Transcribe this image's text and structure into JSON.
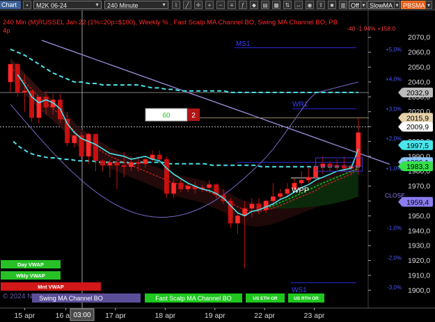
{
  "toolbar": {
    "chart_tag": "Chart",
    "symbol": "M2K 06-24",
    "interval": "240 Minute",
    "toggle1": "Off",
    "toggle2": "SlowMA",
    "toggle3": "PBSMA"
  },
  "header": {
    "title": "240 Min (M)RUSSEL Jan 22 (1%=20p=$100), Weekly % , Fast Scalp MA Channel BO, Swing MA Channel BO, PB",
    "subtitle": "4p",
    "change": "-40 -1.94% +158.0"
  },
  "levels": {
    "ms1": "MS1",
    "wr1": "WR1",
    "wpp": "WPP",
    "ws1": "WS1",
    "close": "CLOSE"
  },
  "box": {
    "left_value": "60",
    "right_value": "2"
  },
  "price_tags": [
    {
      "text": "2032,9",
      "price": 2032.9,
      "bg": "#bcbcbc",
      "fg": "#000000"
    },
    {
      "text": "2015,9",
      "price": 2015.9,
      "bg": "#e6d2aa",
      "fg": "#000000"
    },
    {
      "text": "2009,9",
      "price": 2009.9,
      "bg": "#ffffff",
      "fg": "#000000"
    },
    {
      "text": "1997,5",
      "price": 1997.5,
      "bg": "#49e6ec",
      "fg": "#000000"
    },
    {
      "text": "1986,1",
      "price": 1986.1,
      "bg": "#8cc6ff",
      "fg": "#000000"
    },
    {
      "text": "1983,3",
      "price": 1983.3,
      "bg": "#35e04a",
      "fg": "#000000"
    },
    {
      "text": "1959,4",
      "price": 1959.4,
      "bg": "#8b7cf0",
      "fg": "#000000"
    }
  ],
  "legend_buttons": {
    "day_vwap": "Day VWAP",
    "wkly_vwap": "Wkly VWAP",
    "mnt_vwap": "Mnt VWAP",
    "swing": "Swing MA Channel BO",
    "fast": "Fast Scalp MA Channel BO",
    "us_eth": "US ETH OR",
    "us_rth": "US RTH OR"
  },
  "copyright": "© 2024 NinjaTrader, LLC",
  "crosshair_time": "03:00",
  "colors": {
    "up": "#ff2020",
    "down": "#c80000",
    "fast_ma": "#49e6ec",
    "slow_ma": "#e02020",
    "swing_upper": "#9080d0",
    "trend_green": "#30d040",
    "pivot_blue": "#3a3ad8",
    "crosshair": "#c8c8c8"
  },
  "chart_data": {
    "type": "candlestick",
    "symbol": "M2K 06-24",
    "interval": "240 Minute",
    "y_axis": {
      "range": [
        1895,
        2075
      ],
      "ticks": [
        2070,
        2060,
        2050,
        2040,
        2030,
        2020,
        2010,
        2000,
        1990,
        1980,
        1970,
        1960,
        1950,
        1940,
        1930,
        1920,
        1910,
        1900
      ],
      "tick_labels": [
        "2070,0",
        "2060,0",
        "2050,0",
        "2040,0",
        "2030,0",
        "2020,0",
        "2010,0",
        "2000,0",
        "1990,0",
        "1980,0",
        "1970,0",
        "1960,0",
        "1950,0",
        "1940,0",
        "1930,0",
        "1920,0",
        "1910,0",
        "1900,0"
      ]
    },
    "pct_axis": [
      {
        "label": "+5,0%",
        "price": 2062
      },
      {
        "label": "+4,0%",
        "price": 2042
      },
      {
        "label": "+3,0%",
        "price": 2022
      },
      {
        "label": "+2,0%",
        "price": 2002
      },
      {
        "label": "+1,0%",
        "price": 1982
      },
      {
        "label": "-1,0%",
        "price": 1942
      },
      {
        "label": "-2,0%",
        "price": 1922
      },
      {
        "label": "-3,0%",
        "price": 1902
      }
    ],
    "x_labels": [
      {
        "label": "15 apr",
        "index": 2
      },
      {
        "label": "16 apr",
        "index": 7.8
      },
      {
        "label": "17 apr",
        "index": 14.8
      },
      {
        "label": "18 apr",
        "index": 21.8
      },
      {
        "label": "19 apr",
        "index": 28.8
      },
      {
        "label": "22 apr",
        "index": 35.8
      },
      {
        "label": "23 apr",
        "index": 42.8
      }
    ],
    "candles": [
      {
        "o": 2040,
        "h": 2051,
        "c": 2052,
        "l": 2033
      },
      {
        "o": 2052,
        "h": 2053,
        "c": 2033,
        "l": 2030
      },
      {
        "o": 2033,
        "h": 2045,
        "c": 2034,
        "l": 2020
      },
      {
        "o": 2034,
        "h": 2033,
        "c": 2016,
        "l": 2013
      },
      {
        "o": 2016,
        "h": 2030,
        "c": 2030,
        "l": 2012
      },
      {
        "o": 2030,
        "h": 2034,
        "c": 2023,
        "l": 2018
      },
      {
        "o": 2023,
        "h": 2032,
        "c": 2028,
        "l": 2018
      },
      {
        "o": 2028,
        "h": 2032,
        "c": 2015,
        "l": 2012
      },
      {
        "o": 2015,
        "h": 2020,
        "c": 1999,
        "l": 1997
      },
      {
        "o": 1999,
        "h": 2004,
        "c": 2004,
        "l": 1996
      },
      {
        "o": 2004,
        "h": 2006,
        "c": 1990,
        "l": 1988
      },
      {
        "o": 1990,
        "h": 2006,
        "c": 2005,
        "l": 1985
      },
      {
        "o": 2005,
        "h": 2005,
        "c": 1987,
        "l": 1980
      },
      {
        "o": 1987,
        "h": 1988,
        "c": 1984,
        "l": 1980
      },
      {
        "o": 1984,
        "h": 1988,
        "c": 1986,
        "l": 1976
      },
      {
        "o": 1986,
        "h": 1988,
        "c": 1984,
        "l": 1968
      },
      {
        "o": 1984,
        "h": 1993,
        "c": 1983,
        "l": 1976
      },
      {
        "o": 1983,
        "h": 1990,
        "c": 1986,
        "l": 1980
      },
      {
        "o": 1986,
        "h": 1990,
        "c": 1985,
        "l": 1980
      },
      {
        "o": 1985,
        "h": 1990,
        "c": 1988,
        "l": 1982
      },
      {
        "o": 1988,
        "h": 1994,
        "c": 1991,
        "l": 1986
      },
      {
        "o": 1991,
        "h": 1994,
        "c": 1988,
        "l": 1985
      },
      {
        "o": 1988,
        "h": 1990,
        "c": 1965,
        "l": 1962
      },
      {
        "o": 1965,
        "h": 1975,
        "c": 1972,
        "l": 1962
      },
      {
        "o": 1972,
        "h": 1975,
        "c": 1968,
        "l": 1966
      },
      {
        "o": 1968,
        "h": 1972,
        "c": 1970,
        "l": 1966
      },
      {
        "o": 1970,
        "h": 1973,
        "c": 1968,
        "l": 1965
      },
      {
        "o": 1968,
        "h": 1971,
        "c": 1969,
        "l": 1966
      },
      {
        "o": 1969,
        "h": 1974,
        "c": 1971,
        "l": 1966
      },
      {
        "o": 1971,
        "h": 1972,
        "c": 1964,
        "l": 1962
      },
      {
        "o": 1964,
        "h": 1968,
        "c": 1960,
        "l": 1958
      },
      {
        "o": 1960,
        "h": 1962,
        "c": 1945,
        "l": 1942
      },
      {
        "o": 1945,
        "h": 1952,
        "c": 1950,
        "l": 1938
      },
      {
        "o": 1950,
        "h": 1960,
        "c": 1955,
        "l": 1915
      },
      {
        "o": 1955,
        "h": 1962,
        "c": 1958,
        "l": 1949
      },
      {
        "o": 1958,
        "h": 1962,
        "c": 1954,
        "l": 1951
      },
      {
        "o": 1954,
        "h": 1961,
        "c": 1960,
        "l": 1952
      },
      {
        "o": 1960,
        "h": 1972,
        "c": 1963,
        "l": 1955
      },
      {
        "o": 1963,
        "h": 1968,
        "c": 1965,
        "l": 1961
      },
      {
        "o": 1965,
        "h": 1972,
        "c": 1968,
        "l": 1962
      },
      {
        "o": 1968,
        "h": 1975,
        "c": 1972,
        "l": 1966
      },
      {
        "o": 1972,
        "h": 1980,
        "c": 1974,
        "l": 1970
      },
      {
        "o": 1974,
        "h": 1982,
        "c": 1976,
        "l": 1972
      },
      {
        "o": 1976,
        "h": 1985,
        "c": 1983,
        "l": 1974
      },
      {
        "o": 1983,
        "h": 1990,
        "c": 1985,
        "l": 1978
      },
      {
        "o": 1985,
        "h": 1987,
        "c": 1983,
        "l": 1980
      },
      {
        "o": 1983,
        "h": 1988,
        "c": 1984,
        "l": 1981
      },
      {
        "o": 1984,
        "h": 1990,
        "c": 1982,
        "l": 1980
      },
      {
        "o": 1982,
        "h": 1985,
        "c": 1983,
        "l": 1978
      },
      {
        "o": 1983,
        "h": 2016,
        "c": 2006,
        "l": 1978
      }
    ],
    "series": [
      {
        "name": "Fast Scalp MA",
        "values": [
          null,
          2045,
          2038,
          2030,
          2026,
          2028,
          2026,
          2022,
          2012,
          2006,
          2002,
          2000,
          1998,
          1995,
          1992,
          1991,
          1990,
          1988,
          1989,
          1990,
          1988,
          1987,
          1982,
          1978,
          1975,
          1972,
          1970,
          1968,
          1967,
          1965,
          1962,
          1957,
          1952,
          1950,
          1953,
          1954,
          1956,
          1958,
          1961,
          1963,
          1966,
          1969,
          1971,
          1974,
          1976,
          1978,
          1980,
          1981,
          1982,
          1995
        ]
      },
      {
        "name": "Slow MA",
        "values": [
          2050,
          2045,
          2040,
          2035,
          2030,
          2026,
          2022,
          2018,
          2012,
          2007,
          2002,
          1999,
          1996,
          1993,
          1990,
          1988,
          1986,
          1984,
          1982,
          1980,
          1978,
          1976,
          1974,
          1972,
          1971,
          1970,
          1969,
          1968,
          1966,
          1964,
          1962,
          1959,
          1956,
          1954,
          1953,
          1953,
          1954,
          1955,
          1957,
          1959,
          1961,
          1963,
          1965,
          1967,
          1970,
          1972,
          1974,
          1976,
          1978,
          1982
        ]
      },
      {
        "name": "Weekly Average",
        "values": [
          2062,
          2060,
          2058,
          2055,
          2052,
          2049,
          2046,
          2044,
          2042,
          2040,
          2040,
          2039,
          2039,
          2038,
          2038,
          2038,
          2038,
          2038,
          2038,
          2037,
          2036,
          2036,
          2035,
          2035,
          2034,
          2034,
          2034,
          2034,
          2034,
          2034,
          2034,
          2033,
          2033,
          2033,
          2033,
          2033,
          2033,
          2033,
          2033,
          2033,
          2033,
          2033,
          2033,
          2033,
          2033,
          2033,
          2033,
          2033,
          2033,
          2033
        ]
      },
      {
        "name": "Day VWAP",
        "values": [
          2000,
          1996,
          1993,
          1991,
          1990,
          1989,
          1989,
          1988,
          1988,
          1987,
          1987,
          1987,
          1986,
          1986,
          1986,
          1986,
          1986,
          1985,
          1986,
          1986,
          1986,
          1986,
          1985,
          1985,
          1985,
          1985,
          1985,
          1985,
          1984,
          1984,
          1984,
          1984,
          1984,
          1984,
          1984,
          1983,
          1983,
          1983,
          1983,
          1983,
          1983,
          1983,
          1983,
          1983,
          1983,
          1983,
          1983,
          1983,
          1983,
          1983
        ]
      }
    ]
  }
}
